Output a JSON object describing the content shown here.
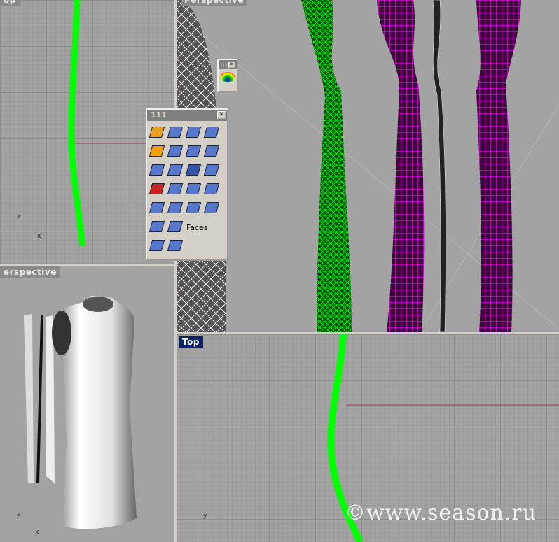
{
  "viewports": {
    "top_left": {
      "label": "op"
    },
    "top_right": {
      "label": "Perspective"
    },
    "bottom_left": {
      "label": "erspective"
    },
    "bottom_right": {
      "label": "Top",
      "active": true
    }
  },
  "toolbar": {
    "title": "111",
    "close": "✕",
    "faces_label": "Faces",
    "icons": [
      "extract-surface-icon",
      "explode-icon",
      "split-icon",
      "trim-icon",
      "explode-star-icon",
      "project-icon",
      "point-move-icon",
      "surface-icon",
      "plane-surface-icon",
      "extrude-icon",
      "text-icon",
      "untrim-icon",
      "box-edges-icon",
      "rotate-face-icon",
      "split-face-icon",
      "cube-face-icon",
      "patch-icon",
      "bend-icon",
      "mirror-icon",
      "faces-move-icon",
      "point-icon",
      "faces-icon",
      "cplane-icon",
      "undo-icon"
    ]
  },
  "mini_toolbar": {
    "title": "...",
    "close": "✕",
    "icons": [
      "zebra-analysis-icon"
    ]
  },
  "axes": {
    "x": "x",
    "y": "y",
    "z": "z"
  },
  "watermark": "©www.season.ru",
  "colors": {
    "viewport_bg": "#a3a3a3",
    "active_label": "#0a246a",
    "mesh_green": "#00ff00",
    "mesh_magenta": "#ff00ff"
  }
}
